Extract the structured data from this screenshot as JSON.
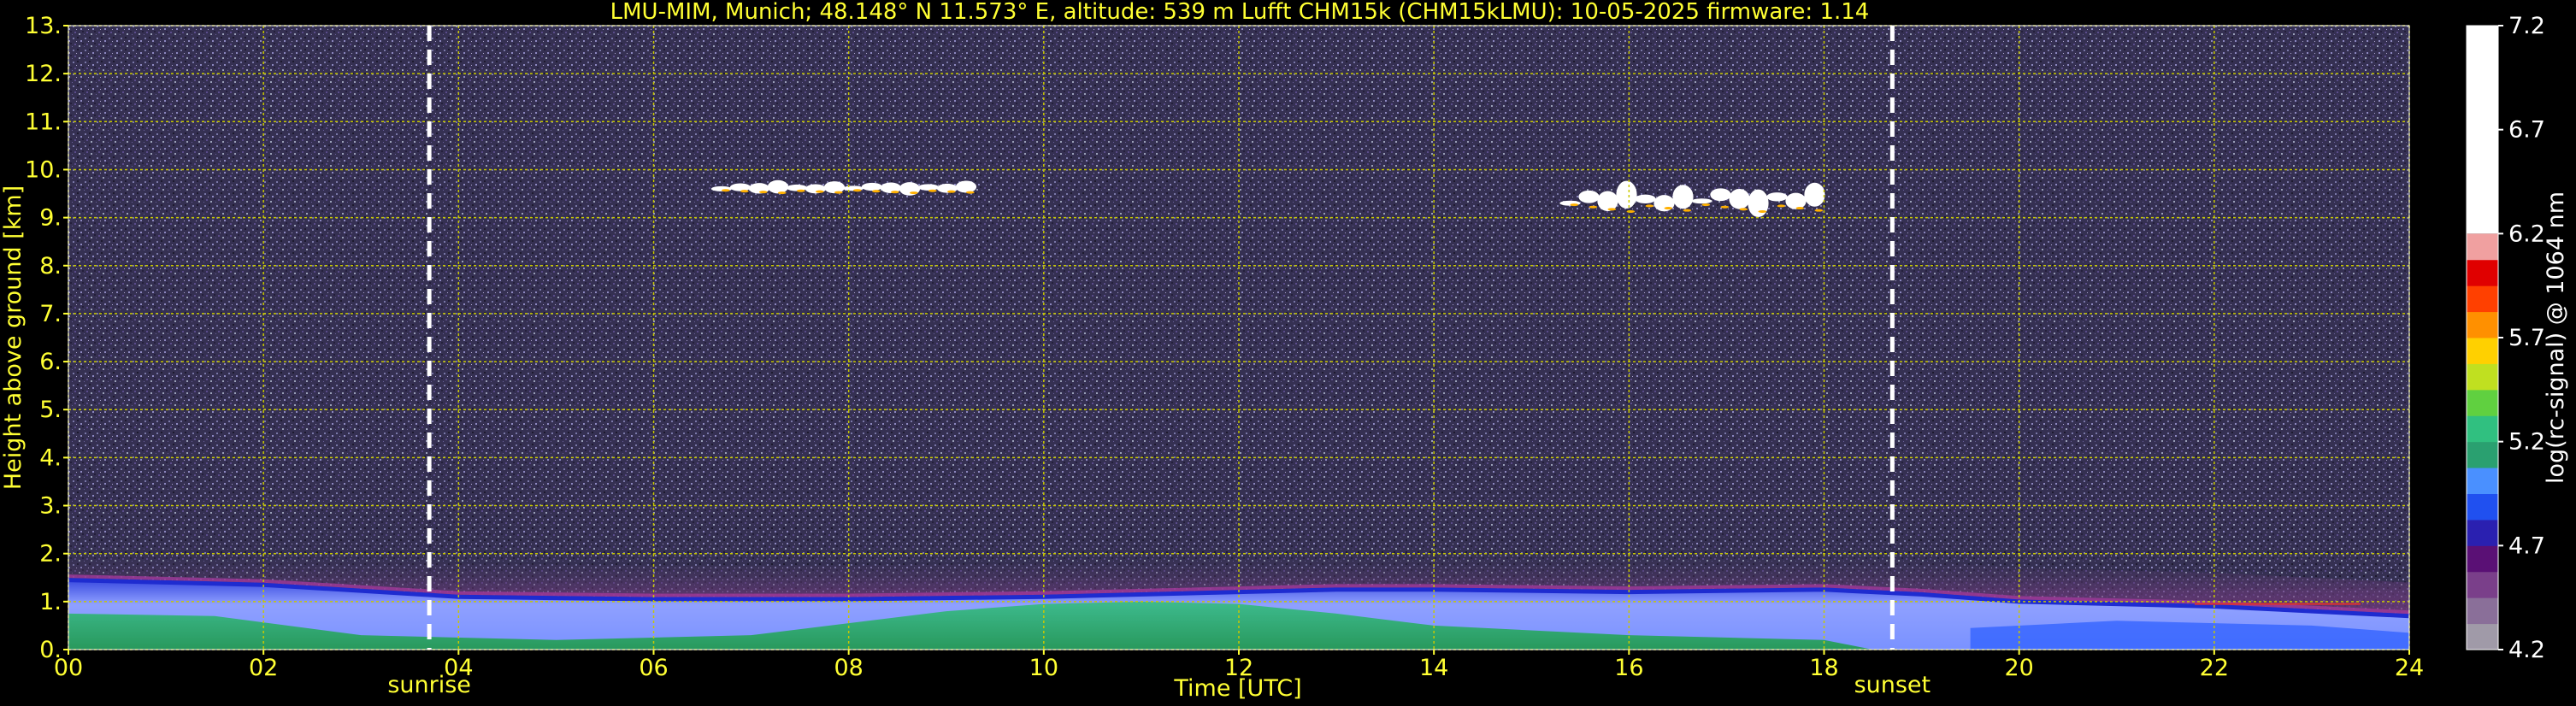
{
  "chart_data": {
    "type": "heatmap",
    "title": "LMU-MIM, Munich; 48.148° N 11.573° E, altitude: 539 m    Lufft CHM15k (CHM15kLMU): 10-05-2025    firmware: 1.14",
    "xlabel": "Time [UTC]",
    "ylabel": "Height above ground [km]",
    "colorbar_label": "log(rc-signal) @ 1064 nm",
    "xlim": [
      0,
      24
    ],
    "ylim": [
      0,
      13
    ],
    "clim": [
      4.2,
      7.2
    ],
    "x_ticks": [
      0,
      2,
      4,
      6,
      8,
      10,
      12,
      14,
      16,
      18,
      20,
      22,
      24
    ],
    "x_tick_labels": [
      "00",
      "02",
      "04",
      "06",
      "08",
      "10",
      "12",
      "14",
      "16",
      "18",
      "20",
      "22",
      "24"
    ],
    "y_ticks": [
      0,
      1,
      2,
      3,
      4,
      5,
      6,
      7,
      8,
      9,
      10,
      11,
      12,
      13
    ],
    "y_tick_labels": [
      "0.",
      "1.",
      "2.",
      "3.",
      "4.",
      "5.",
      "6.",
      "7.",
      "8.",
      "9.",
      "10.",
      "11.",
      "12.",
      "13."
    ],
    "colorbar_ticks": [
      4.2,
      4.7,
      5.2,
      5.7,
      6.2,
      6.7,
      7.2
    ],
    "colorbar_tick_labels": [
      "4.2",
      "4.7",
      "5.2",
      "5.7",
      "6.2",
      "6.7",
      "7.2"
    ],
    "grid": true,
    "events": [
      {
        "label": "sunrise",
        "time": 3.7
      },
      {
        "label": "sunset",
        "time": 18.7
      }
    ],
    "cloud_layers": [
      {
        "t_start": 6.6,
        "t_end": 9.3,
        "height_km": 9.6
      },
      {
        "t_start": 15.3,
        "t_end": 18.0,
        "height_km": 9.3
      }
    ],
    "boundary_layer_top_km": [
      [
        0,
        1.45
      ],
      [
        2,
        1.35
      ],
      [
        4,
        1.1
      ],
      [
        6,
        1.05
      ],
      [
        8,
        1.05
      ],
      [
        10,
        1.1
      ],
      [
        12,
        1.2
      ],
      [
        13,
        1.25
      ],
      [
        14,
        1.25
      ],
      [
        16,
        1.2
      ],
      [
        18,
        1.25
      ],
      [
        19,
        1.15
      ],
      [
        20,
        1.0
      ],
      [
        22,
        0.9
      ],
      [
        24,
        0.7
      ]
    ],
    "colors": {
      "axis_text": "#ffff33",
      "grid": "#c8c800",
      "event_line": "#ffffff",
      "background_noise": "#3a3556",
      "aerosol_layer": "#8e3a8e",
      "boundary_layer": "#6f86ff",
      "mixed_layer_green": "#22aa55",
      "cloud": "#ffffff"
    },
    "colormap": [
      "#a09aa8",
      "#8a6f99",
      "#7a3f8a",
      "#5a1075",
      "#2a20b0",
      "#2050f0",
      "#4a90ff",
      "#2aa070",
      "#30c080",
      "#60d040",
      "#c0e020",
      "#ffd000",
      "#ff9000",
      "#ff4000",
      "#e00000",
      "#f0a0a0",
      "#ffffff"
    ]
  }
}
